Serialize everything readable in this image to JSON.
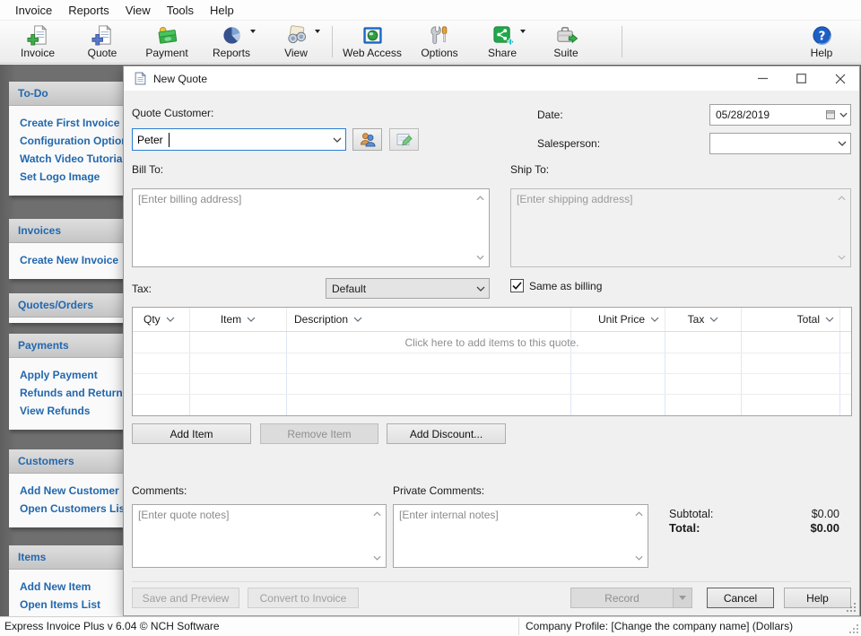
{
  "window": {
    "menu": [
      "Invoice",
      "Reports",
      "View",
      "Tools",
      "Help"
    ],
    "toolbar": [
      {
        "label": "Invoice",
        "icon": "new-invoice-icon"
      },
      {
        "label": "Quote",
        "icon": "new-quote-icon"
      },
      {
        "label": "Payment",
        "icon": "payment-icon"
      },
      {
        "label": "Reports",
        "icon": "reports-icon"
      },
      {
        "label": "View",
        "icon": "view-icon"
      },
      {
        "label": "Web Access",
        "icon": "web-access-icon"
      },
      {
        "label": "Options",
        "icon": "options-icon"
      },
      {
        "label": "Share",
        "icon": "share-icon"
      },
      {
        "label": "Suite",
        "icon": "suite-icon"
      },
      {
        "label": "Help",
        "icon": "help-icon"
      }
    ],
    "status_left": "Express Invoice Plus v 6.04 © NCH Software",
    "status_right": "Company Profile: [Change the company name] (Dollars)"
  },
  "sidebar": {
    "sections": [
      {
        "title": "To-Do",
        "links": [
          "Create First Invoice",
          "Configuration Options",
          "Watch Video Tutorials",
          "Set Logo Image"
        ]
      },
      {
        "title": "Invoices",
        "links": [
          "Create New Invoice"
        ]
      },
      {
        "title": "Quotes/Orders",
        "links": []
      },
      {
        "title": "Payments",
        "links": [
          "Apply Payment",
          "Refunds and Returns",
          "View Refunds"
        ]
      },
      {
        "title": "Customers",
        "links": [
          "Add New Customer",
          "Open Customers List"
        ]
      },
      {
        "title": "Items",
        "links": [
          "Add New Item",
          "Open Items List"
        ]
      }
    ]
  },
  "dialog": {
    "title": "New Quote",
    "fields": {
      "quote_customer_label": "Quote Customer:",
      "customer_value": "Peter",
      "date_label": "Date:",
      "date_value": "05/28/2019",
      "salesperson_label": "Salesperson:",
      "bill_to_label": "Bill To:",
      "bill_to_placeholder": "[Enter billing address]",
      "ship_to_label": "Ship To:",
      "ship_to_placeholder": "[Enter shipping address]",
      "tax_label": "Tax:",
      "tax_value": "Default",
      "same_as_billing_label": "Same as billing",
      "comments_label": "Comments:",
      "comments_placeholder": "[Enter quote notes]",
      "private_comments_label": "Private Comments:",
      "private_comments_placeholder": "[Enter internal notes]"
    },
    "table": {
      "columns": [
        "Qty",
        "Item",
        "Description",
        "Unit Price",
        "Tax",
        "Total"
      ],
      "empty_text": "Click here to add items to this quote."
    },
    "item_buttons": {
      "add_item": "Add Item",
      "remove_item": "Remove Item",
      "add_discount": "Add Discount..."
    },
    "totals": {
      "subtotal_label": "Subtotal:",
      "subtotal_value": "$0.00",
      "total_label": "Total:",
      "total_value": "$0.00"
    },
    "footer_buttons": {
      "save_preview": "Save and Preview",
      "convert": "Convert to Invoice",
      "record": "Record",
      "cancel": "Cancel",
      "help": "Help"
    }
  },
  "colors": {
    "link_blue": "#2268ae",
    "sidebar_bg": "#6d6d6d",
    "focus_blue": "#2a7fd4",
    "grid_blue": "#dde7f3"
  }
}
